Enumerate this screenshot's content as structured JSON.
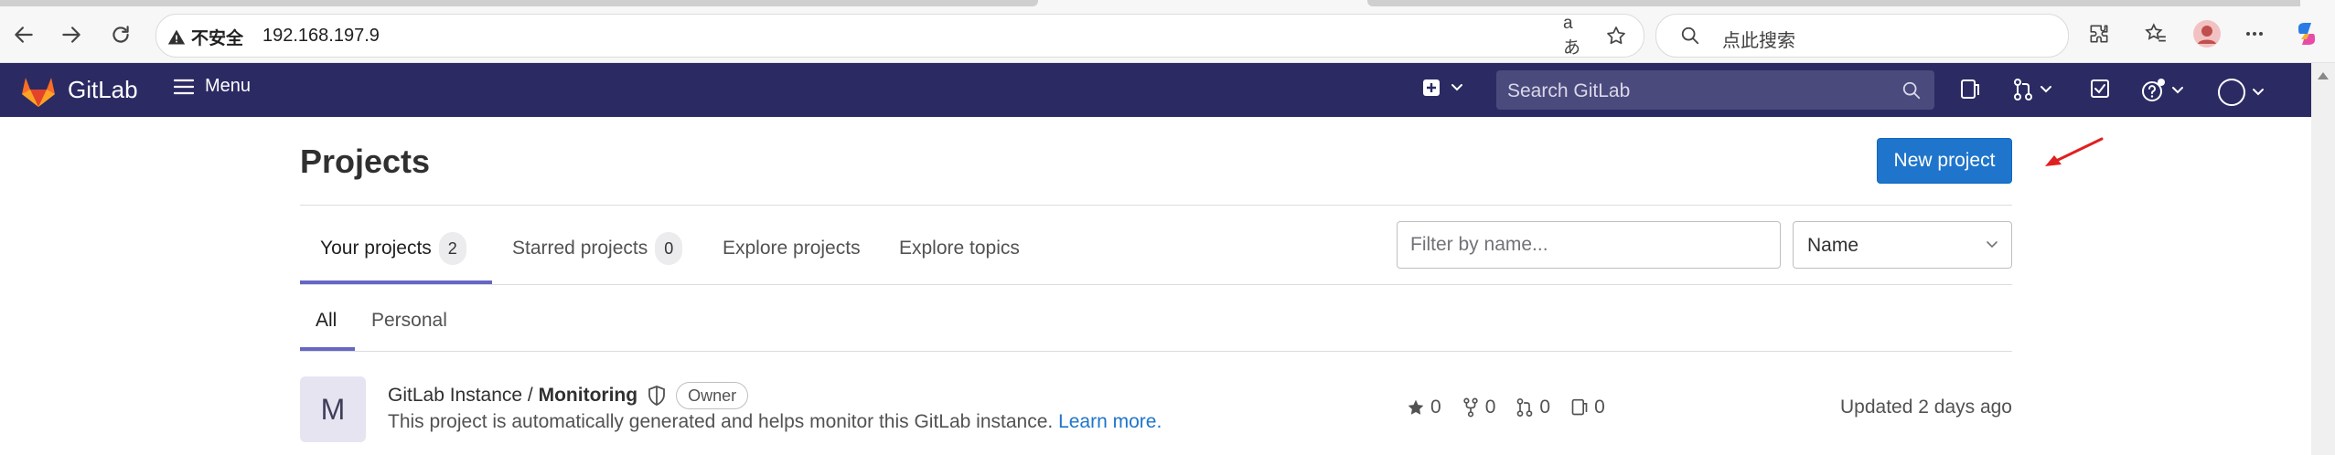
{
  "browser": {
    "security_label": "不安全",
    "url": "192.168.197.9",
    "search_placeholder": "点此搜索"
  },
  "header": {
    "brand": "GitLab",
    "menu_label": "Menu",
    "search_placeholder": "Search GitLab"
  },
  "page": {
    "title": "Projects",
    "new_project_label": "New project"
  },
  "tabs": [
    {
      "label": "Your projects",
      "count": "2"
    },
    {
      "label": "Starred projects",
      "count": "0"
    },
    {
      "label": "Explore projects"
    },
    {
      "label": "Explore topics"
    }
  ],
  "filter": {
    "placeholder": "Filter by name..."
  },
  "sort": {
    "selected": "Name"
  },
  "subtabs": [
    {
      "label": "All"
    },
    {
      "label": "Personal"
    }
  ],
  "projects": [
    {
      "avatar_letter": "M",
      "namespace": "GitLab Instance /",
      "name": "Monitoring",
      "role": "Owner",
      "description": "This project is automatically generated and helps monitor this GitLab instance.",
      "description_link": "Learn more.",
      "stars": "0",
      "forks": "0",
      "merge_requests": "0",
      "issues": "0",
      "updated": "Updated 2 days ago"
    }
  ],
  "colors": {
    "header_bg": "#2b2a63",
    "primary_button": "#1f75cb",
    "tab_active_underline": "#6666c4",
    "annotation_arrow": "#e02020"
  },
  "icons": [
    "back-icon",
    "forward-icon",
    "refresh-icon",
    "warning-icon",
    "read-aloud-icon",
    "favorite-icon",
    "search-icon",
    "extensions-icon",
    "favorites-icon",
    "profile-icon",
    "more-icon",
    "copilot-icon",
    "gitlab-logo-icon",
    "hamburger-icon",
    "plus-square-icon",
    "search-icon",
    "sidebar-icon",
    "merge-request-icon",
    "todo-icon",
    "help-icon",
    "avatar-icon",
    "shield-icon",
    "star-icon",
    "fork-icon",
    "merge-request-icon",
    "issue-icon",
    "chevron-down-icon",
    "red-arrow-annotation"
  ]
}
